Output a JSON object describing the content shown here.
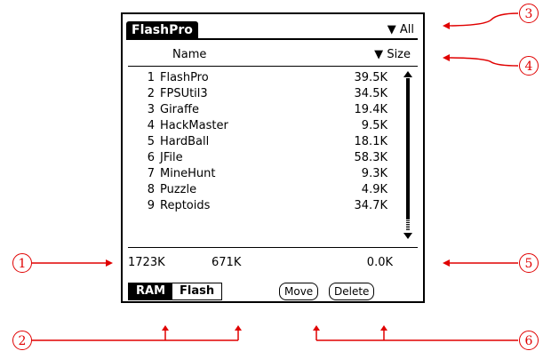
{
  "app": {
    "title": "FlashPro",
    "category": "All"
  },
  "columns": {
    "name": "Name",
    "size": "Size"
  },
  "rows": [
    {
      "num": "1",
      "name": "FlashPro",
      "size": "39.5K"
    },
    {
      "num": "2",
      "name": "FPSUtil3",
      "size": "34.5K"
    },
    {
      "num": "3",
      "name": "Giraffe",
      "size": "19.4K"
    },
    {
      "num": "4",
      "name": "HackMaster",
      "size": "9.5K"
    },
    {
      "num": "5",
      "name": "HardBall",
      "size": "18.1K"
    },
    {
      "num": "6",
      "name": "JFile",
      "size": "58.3K"
    },
    {
      "num": "7",
      "name": "MineHunt",
      "size": "9.3K"
    },
    {
      "num": "8",
      "name": "Puzzle",
      "size": "4.9K"
    },
    {
      "num": "9",
      "name": "Reptoids",
      "size": "34.7K"
    }
  ],
  "totals": {
    "ram": "1723K",
    "flash": "671K",
    "selected": "0.0K"
  },
  "segments": {
    "ram": "RAM",
    "flash": "Flash"
  },
  "buttons": {
    "move": "Move",
    "delete": "Delete"
  },
  "annotations": [
    "1",
    "2",
    "3",
    "4",
    "5",
    "6"
  ],
  "colors": {
    "annotation": "#e00000",
    "screen_fg": "#000000"
  },
  "icons": {
    "category_dropdown": "triangle-down-icon",
    "sort_dropdown": "triangle-down-icon",
    "scroll_up": "triangle-up-icon",
    "scroll_down": "triangle-down-icon"
  }
}
